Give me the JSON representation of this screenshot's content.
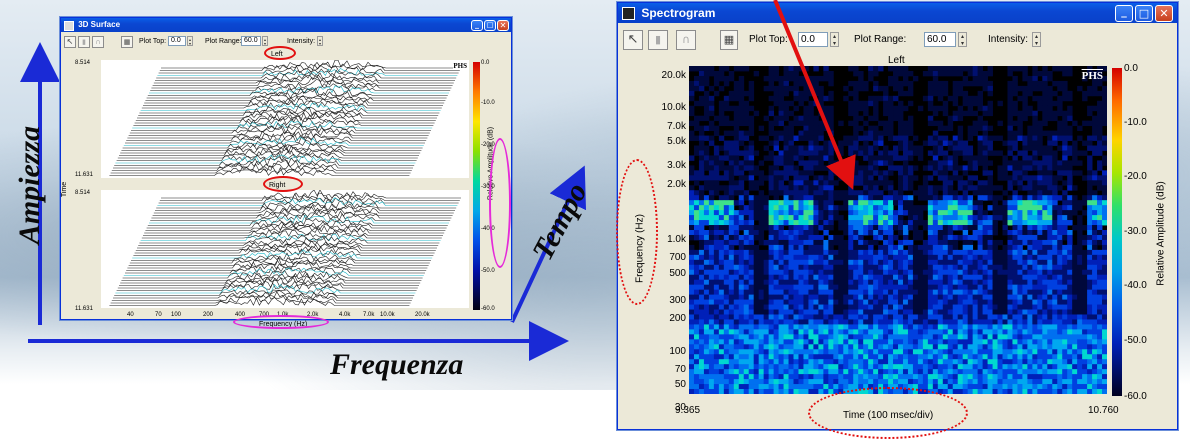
{
  "colors": {
    "accent_blue": "#1a2ad6",
    "annotation_red": "#e21010",
    "annotation_pink": "#e52ad9",
    "xp_title": "#0b47d2"
  },
  "overlay_labels": {
    "amplitude": "Ampiezza",
    "frequency": "Frequenza",
    "time": "Tempo"
  },
  "surface_window": {
    "title": "3D Surface",
    "toolbar": {
      "plot_top_label": "Plot Top:",
      "plot_top_value": "0.0",
      "plot_range_label": "Plot Range:",
      "plot_range_value": "60.0",
      "intensity_label": "Intensity:"
    },
    "channels": {
      "left": "Left",
      "right": "Right"
    },
    "time_axis_label": "Time",
    "time_ticks": {
      "top_start": "8.514",
      "top_end": "11.631",
      "bottom_start": "8.514",
      "bottom_end": "11.631"
    },
    "freq_ticks": [
      "40",
      "70",
      "100",
      "200",
      "400",
      "700",
      "1.0k",
      "2.0k",
      "4.0k",
      "7.0k",
      "10.0k",
      "20.0k"
    ],
    "freq_axis_label": "Frequency (Hz)",
    "logo": "PHS",
    "colorbar_ticks": [
      "0.0",
      "-10.0",
      "-20.0",
      "-30.0",
      "-40.0",
      "-50.0",
      "-60.0"
    ],
    "colorbar_label": "Relative Amplitude (dB)"
  },
  "spectrogram_window": {
    "title": "Spectrogram",
    "toolbar": {
      "plot_top_label": "Plot Top:",
      "plot_top_value": "0.0",
      "plot_range_label": "Plot Range:",
      "plot_range_value": "60.0",
      "intensity_label": "Intensity:"
    },
    "channel": "Left",
    "logo": "PHS",
    "freq_ticks": [
      "20.0k",
      "10.0k",
      "7.0k",
      "5.0k",
      "3.0k",
      "2.0k",
      "1.0k",
      "700",
      "500",
      "300",
      "200",
      "100",
      "70",
      "50",
      "30"
    ],
    "freq_axis_label": "Frequency (Hz)",
    "time_start": "9.365",
    "time_end": "10.760",
    "time_axis_label": "Time (100 msec/div)",
    "colorbar_ticks": [
      "0.0",
      "-10.0",
      "-20.0",
      "-30.0",
      "-40.0",
      "-50.0",
      "-60.0"
    ],
    "colorbar_label": "Relative Amplitude (dB)"
  }
}
